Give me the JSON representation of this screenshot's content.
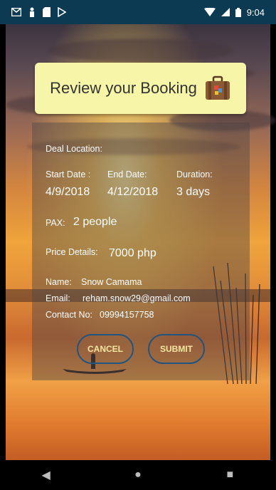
{
  "status_bar": {
    "time": "9:04"
  },
  "header": {
    "title": "Review your Booking",
    "icon": "suitcase-icon"
  },
  "booking": {
    "deal_location_label": "Deal Location:",
    "deal_location_value": "",
    "start_date_label": "Start Date :",
    "end_date_label": "End Date:",
    "duration_label": "Duration:",
    "start_date": "4/9/2018",
    "end_date": "4/12/2018",
    "duration": "3 days",
    "pax_label": "PAX:",
    "pax": "2 people",
    "price_label": "Price Details:",
    "price": "7000 php",
    "name_label": "Name:",
    "name": "Snow Camama",
    "email_label": "Email:",
    "email": "reham.snow29@gmail.com",
    "contact_label": "Contact No:",
    "contact": "09994157758"
  },
  "buttons": {
    "cancel": "CANCEL",
    "submit": "SUBMIT"
  },
  "nav": {
    "back": "◀",
    "home": "●",
    "recents": "■"
  },
  "colors": {
    "status_bar": "#0b3a52",
    "header_card": "#f7f5a8",
    "button_border": "#1f5580",
    "button_text": "#f5e6a2"
  }
}
